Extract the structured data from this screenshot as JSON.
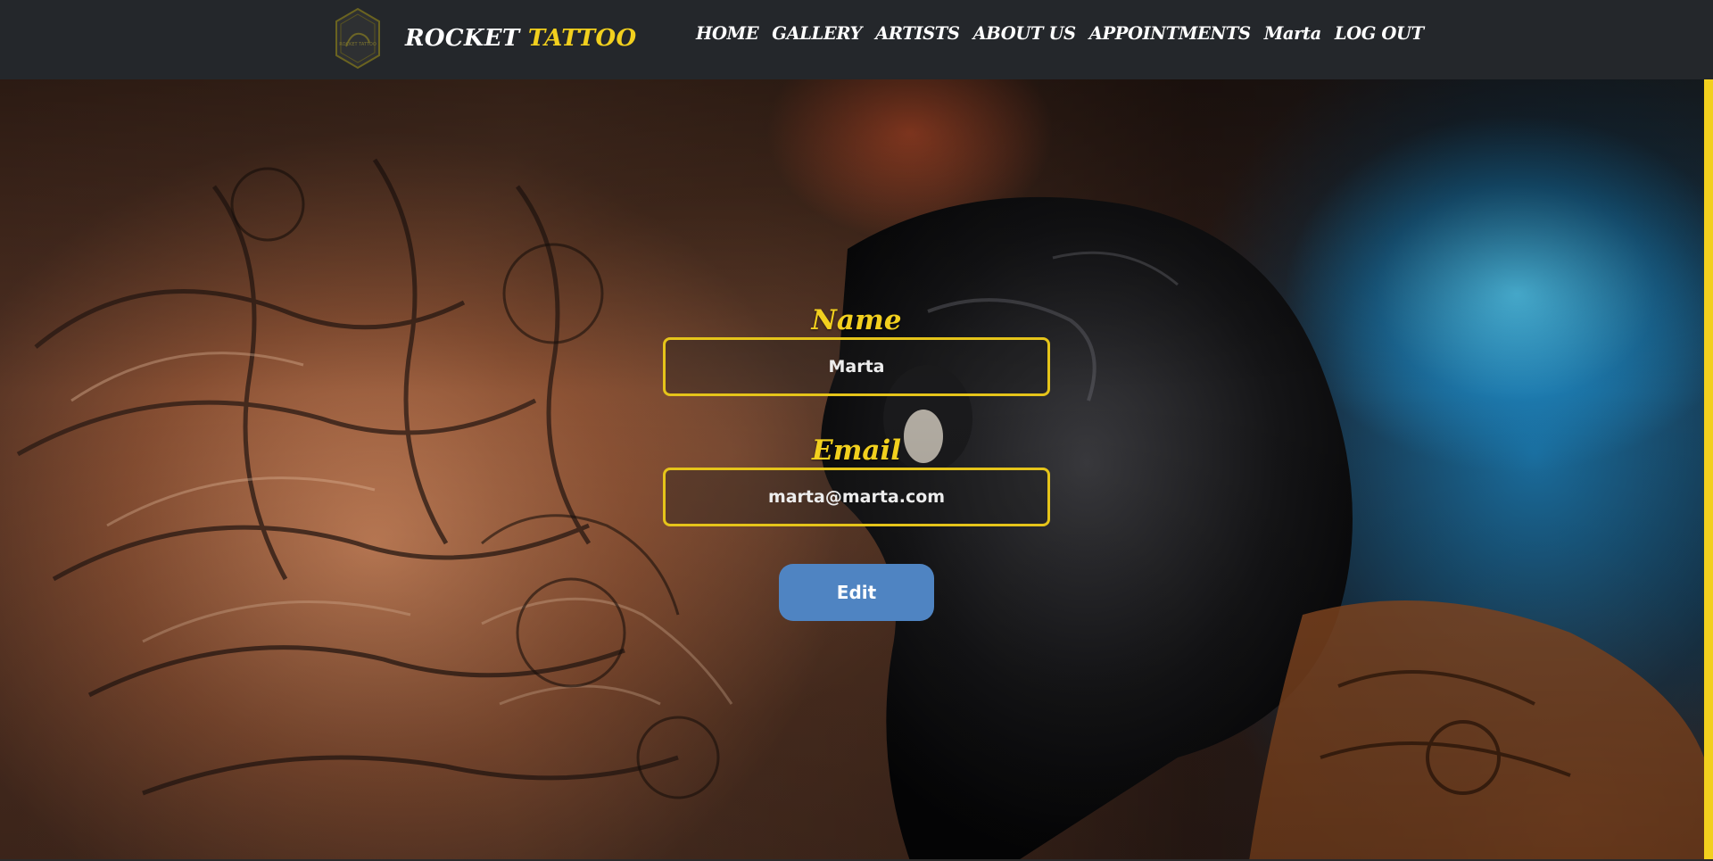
{
  "brand": {
    "name_main": "ROCKET",
    "name_accent": "TATTOO",
    "logo_icon": "hexagon-logo-icon",
    "logo_text": "ROCKET TATTOO"
  },
  "nav": {
    "home": "HOME",
    "gallery": "GALLERY",
    "artists": "ARTISTS",
    "about": "ABOUT US",
    "appointments": "APPOINTMENTS",
    "user": "Marta",
    "logout": "LOG OUT"
  },
  "profile_form": {
    "name_label": "Name",
    "name_value": "Marta",
    "email_label": "Email",
    "email_value": "marta@marta.com",
    "edit_label": "Edit"
  },
  "colors": {
    "header_bg": "#24272b",
    "accent_yellow": "#f2d01e",
    "button_blue": "#4f84c2"
  }
}
